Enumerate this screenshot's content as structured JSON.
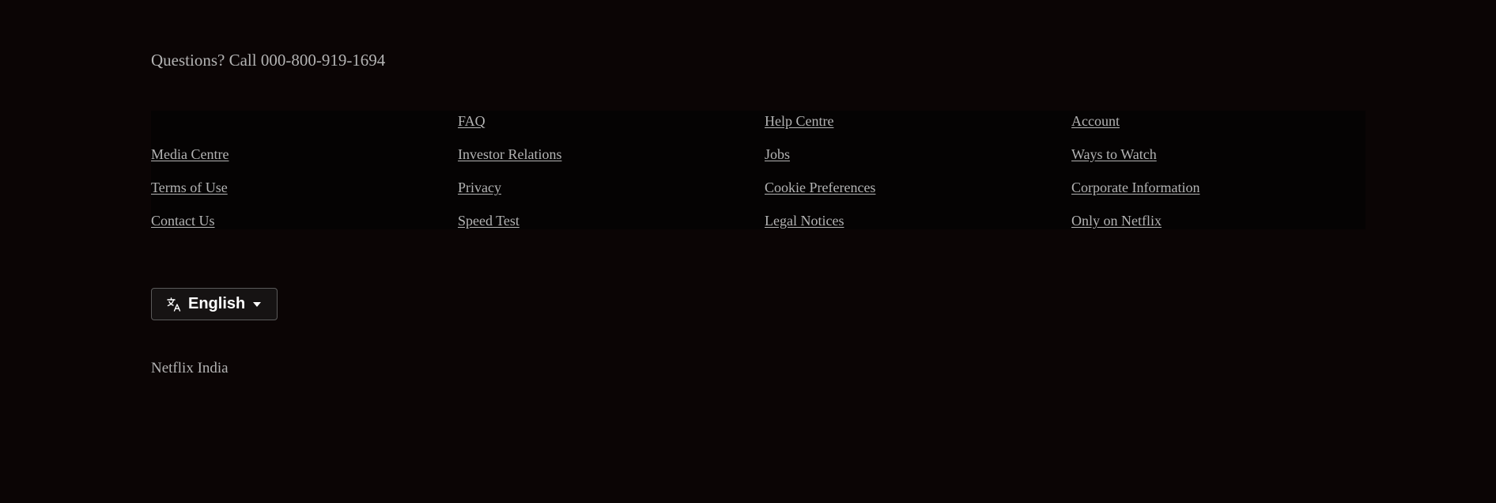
{
  "footer": {
    "questions_prefix": "Questions? Call ",
    "phone": "000-800-919-1694",
    "links": [
      [
        "",
        "FAQ",
        "Help Centre",
        "Account"
      ],
      [
        "Media Centre",
        "Investor Relations",
        "Jobs",
        "Ways to Watch"
      ],
      [
        "Terms of Use",
        "Privacy",
        "Cookie Preferences",
        "Corporate Information"
      ],
      [
        "Contact Us",
        "Speed Test",
        "Legal Notices",
        "Only on Netflix"
      ]
    ],
    "language": {
      "selected": "English",
      "icon": "translate-icon"
    },
    "region": "Netflix India"
  }
}
